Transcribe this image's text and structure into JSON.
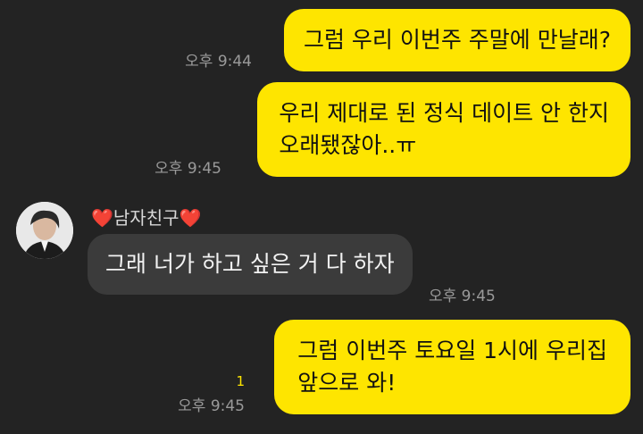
{
  "messages": [
    {
      "lines": [
        "그럼 우리 이번주 주말에 만날래?"
      ],
      "time": "오후 9:44"
    },
    {
      "lines": [
        "우리 제대로 된 정식 데이트 안 한지",
        "오래됐잖아..ㅠ"
      ],
      "time": "오후 9:45"
    },
    {
      "sender": "남자친구",
      "sender_prefix": "❤️",
      "sender_suffix": "❤️",
      "lines": [
        "그래 너가 하고 싶은 거 다 하자"
      ],
      "time": "오후 9:45"
    },
    {
      "lines": [
        "그럼 이번주 토요일 1시에 우리집",
        "앞으로 와!"
      ],
      "time": "오후 9:45",
      "unread": "1"
    }
  ],
  "colors": {
    "my_bubble": "#FEE500",
    "their_bubble": "#3b3b3b",
    "background": "#232323"
  }
}
